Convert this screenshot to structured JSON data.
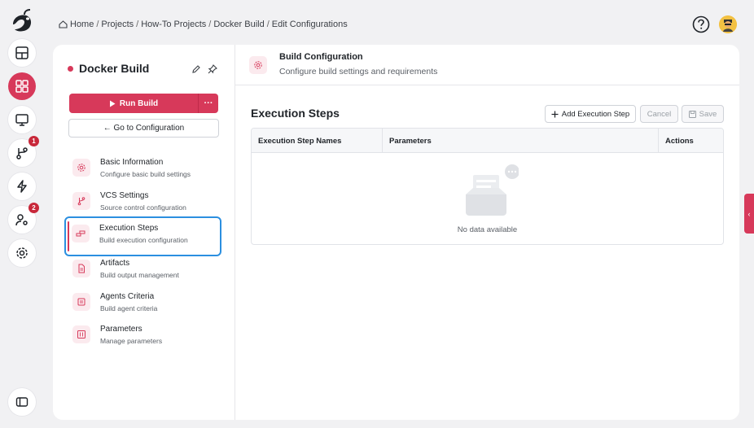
{
  "rail": {
    "items": [
      {
        "icon": "dashboard-icon"
      },
      {
        "icon": "apps-grid-icon",
        "active": true
      },
      {
        "icon": "monitor-icon"
      },
      {
        "icon": "git-branch-icon",
        "badge": "1"
      },
      {
        "icon": "lightning-icon"
      },
      {
        "icon": "user-settings-icon",
        "badge": "2"
      },
      {
        "icon": "gear-icon"
      }
    ],
    "bottom_icon": "sidebar-toggle-icon"
  },
  "breadcrumb": [
    "Home",
    "Projects",
    "How-To Projects",
    "Docker Build",
    "Edit Configurations"
  ],
  "build": {
    "name": "Docker Build",
    "run_label": "Run Build",
    "more_label": "···",
    "goto_label": "← Go to Configuration"
  },
  "nav": [
    {
      "title": "Basic Information",
      "subtitle": "Configure basic build settings",
      "icon": "gear-icon"
    },
    {
      "title": "VCS Settings",
      "subtitle": "Source control configuration",
      "icon": "git-branch-icon"
    },
    {
      "title": "Execution Steps",
      "subtitle": "Build execution configuration",
      "icon": "steps-icon",
      "selected": true
    },
    {
      "title": "Artifacts",
      "subtitle": "Build output management",
      "icon": "file-icon"
    },
    {
      "title": "Agents Criteria",
      "subtitle": "Build agent criteria",
      "icon": "agent-icon"
    },
    {
      "title": "Parameters",
      "subtitle": "Manage parameters",
      "icon": "parameters-icon"
    }
  ],
  "header": {
    "title": "Build Configuration",
    "subtitle": "Configure build settings and requirements"
  },
  "section": {
    "title": "Execution Steps",
    "add_label": "Add Execution Step",
    "cancel_label": "Cancel",
    "save_label": "Save"
  },
  "table": {
    "columns": [
      "Execution Step Names",
      "Parameters",
      "Actions"
    ],
    "empty_text": "No data available"
  },
  "side_tab": "‹",
  "colors": {
    "accent": "#d7395a",
    "selection": "#2b8fe0"
  }
}
